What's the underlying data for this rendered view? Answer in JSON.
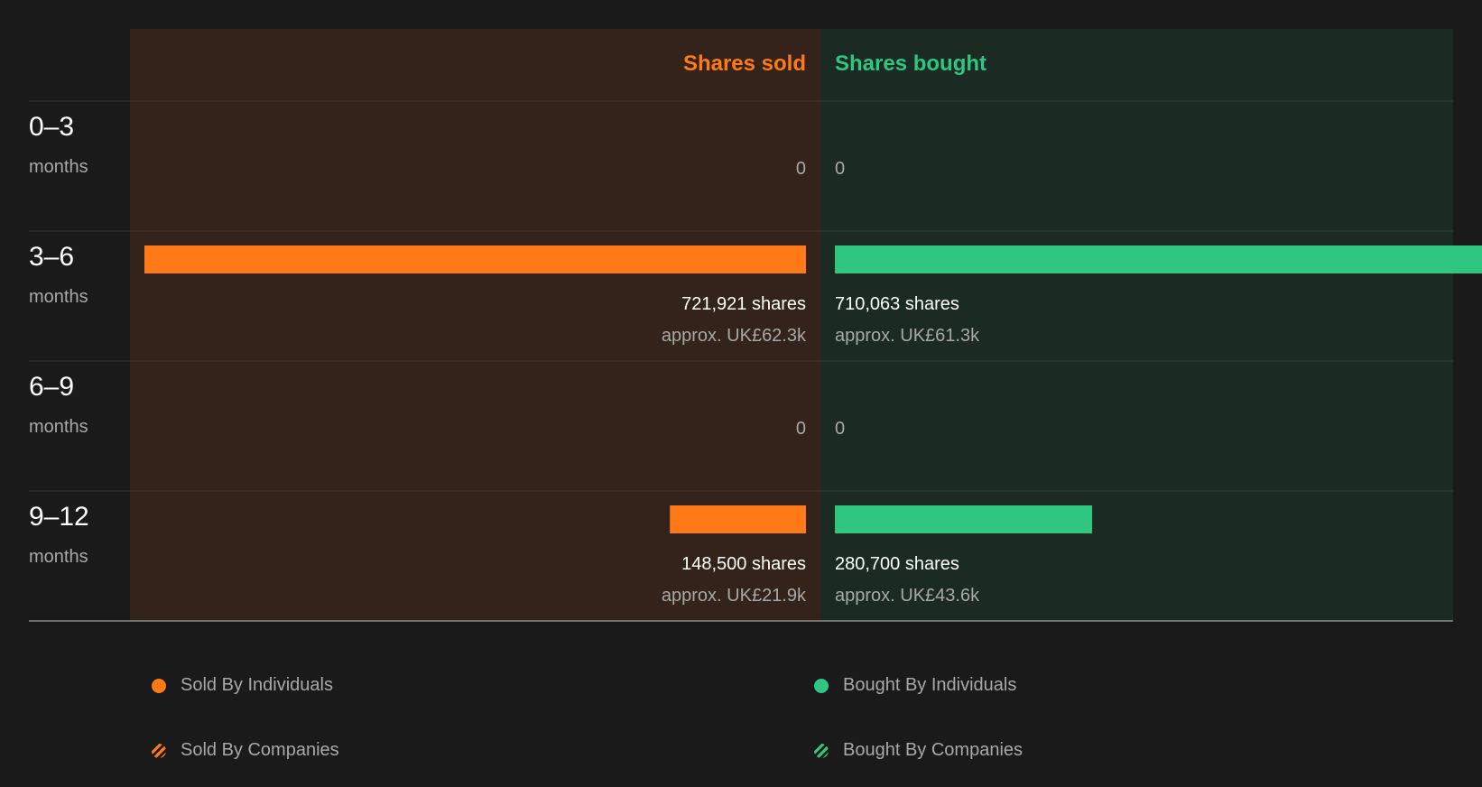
{
  "colors": {
    "background": "#1a1a1a",
    "sold_panel": "#33231b",
    "bought_panel": "#1c2a24",
    "sold": "#ff7a17",
    "bought": "#2ec680",
    "muted": "#a8a8a8",
    "divider": "#3a3a3a"
  },
  "chart_data": {
    "type": "bar",
    "layout": "diverging-horizontal",
    "columns": {
      "sold": "Shares sold",
      "bought": "Shares bought"
    },
    "period_unit": "months",
    "categories": [
      "0–3",
      "3–6",
      "6–9",
      "9–12"
    ],
    "series": [
      {
        "name": "Shares sold",
        "values": [
          0,
          721921,
          0,
          148500
        ],
        "labels": [
          "0",
          "721,921 shares",
          "0",
          "148,500 shares"
        ],
        "approx": [
          "",
          "approx. UK£62.3k",
          "",
          "approx. UK£21.9k"
        ]
      },
      {
        "name": "Shares bought",
        "values": [
          0,
          710063,
          0,
          280700
        ],
        "labels": [
          "0",
          "710,063 shares",
          "0",
          "280,700 shares"
        ],
        "approx": [
          "",
          "approx. UK£61.3k",
          "",
          "approx. UK£43.6k"
        ]
      }
    ]
  },
  "legend": {
    "sold_individuals": "Sold By Individuals",
    "sold_companies": "Sold By Companies",
    "bought_individuals": "Bought By Individuals",
    "bought_companies": "Bought By Companies"
  }
}
